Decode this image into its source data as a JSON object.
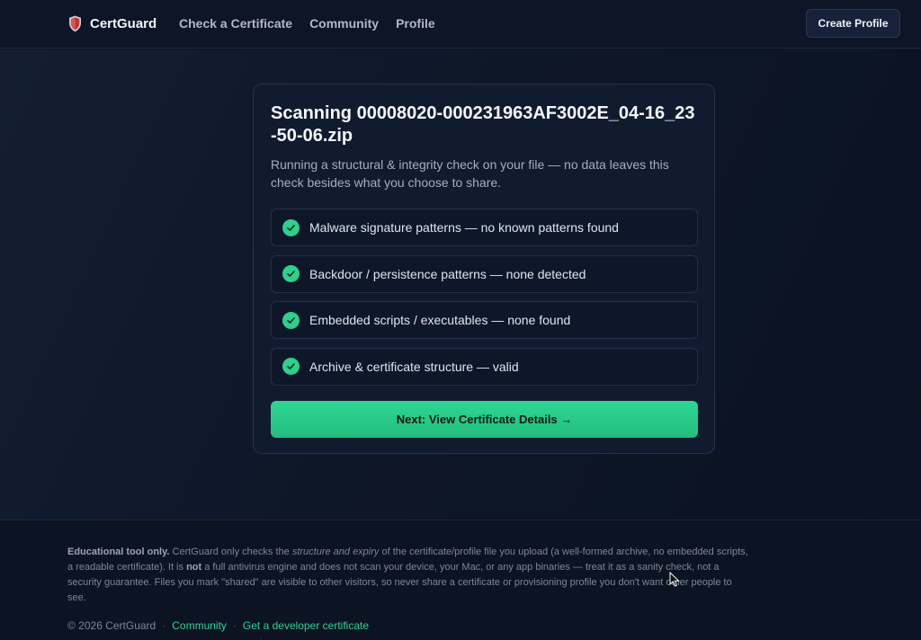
{
  "app": {
    "brand": "CertGuard",
    "nav": [
      "Check a Certificate",
      "Community",
      "Profile"
    ],
    "create_button": "Create Profile"
  },
  "scan": {
    "title": "Scanning 00008020-000231963AF3002E_04-16_23-50-06.zip",
    "subtitle": "Running a structural & integrity check on your file — no data leaves this check besides what you choose to share.",
    "checks": [
      "Malware signature patterns — no known patterns found",
      "Backdoor / persistence patterns — none detected",
      "Embedded scripts / executables — none found",
      "Archive & certificate structure — valid"
    ],
    "next_button": "Next: View Certificate Details →"
  },
  "footer": {
    "disclaimer_bold": "Educational tool only.",
    "disclaimer_1": " CertGuard only checks the ",
    "disclaimer_em": "structure and expiry",
    "disclaimer_2": " of the certificate/profile file you upload (a well-formed archive, no embedded scripts, a readable certificate). It is ",
    "disclaimer_not": "not",
    "disclaimer_3": " a full antivirus engine and does not scan your device, your Mac, or any app binaries — treat it as a sanity check, not a security guarantee. Files you mark \"shared\" are visible to other visitors, so never share a certificate or provisioning profile you don't want other people to see.",
    "copyright": "© 2026 CertGuard",
    "sep": "·",
    "links": [
      "Community",
      "Get a developer certificate"
    ]
  },
  "colors": {
    "accent": "#2fcf8c",
    "background": "#0c1424",
    "card": "#111b30",
    "brand_shield": "#e0524a"
  },
  "icons": {
    "brand": "shield-icon",
    "check": "check-icon",
    "cursor": "mouse-pointer-icon"
  }
}
